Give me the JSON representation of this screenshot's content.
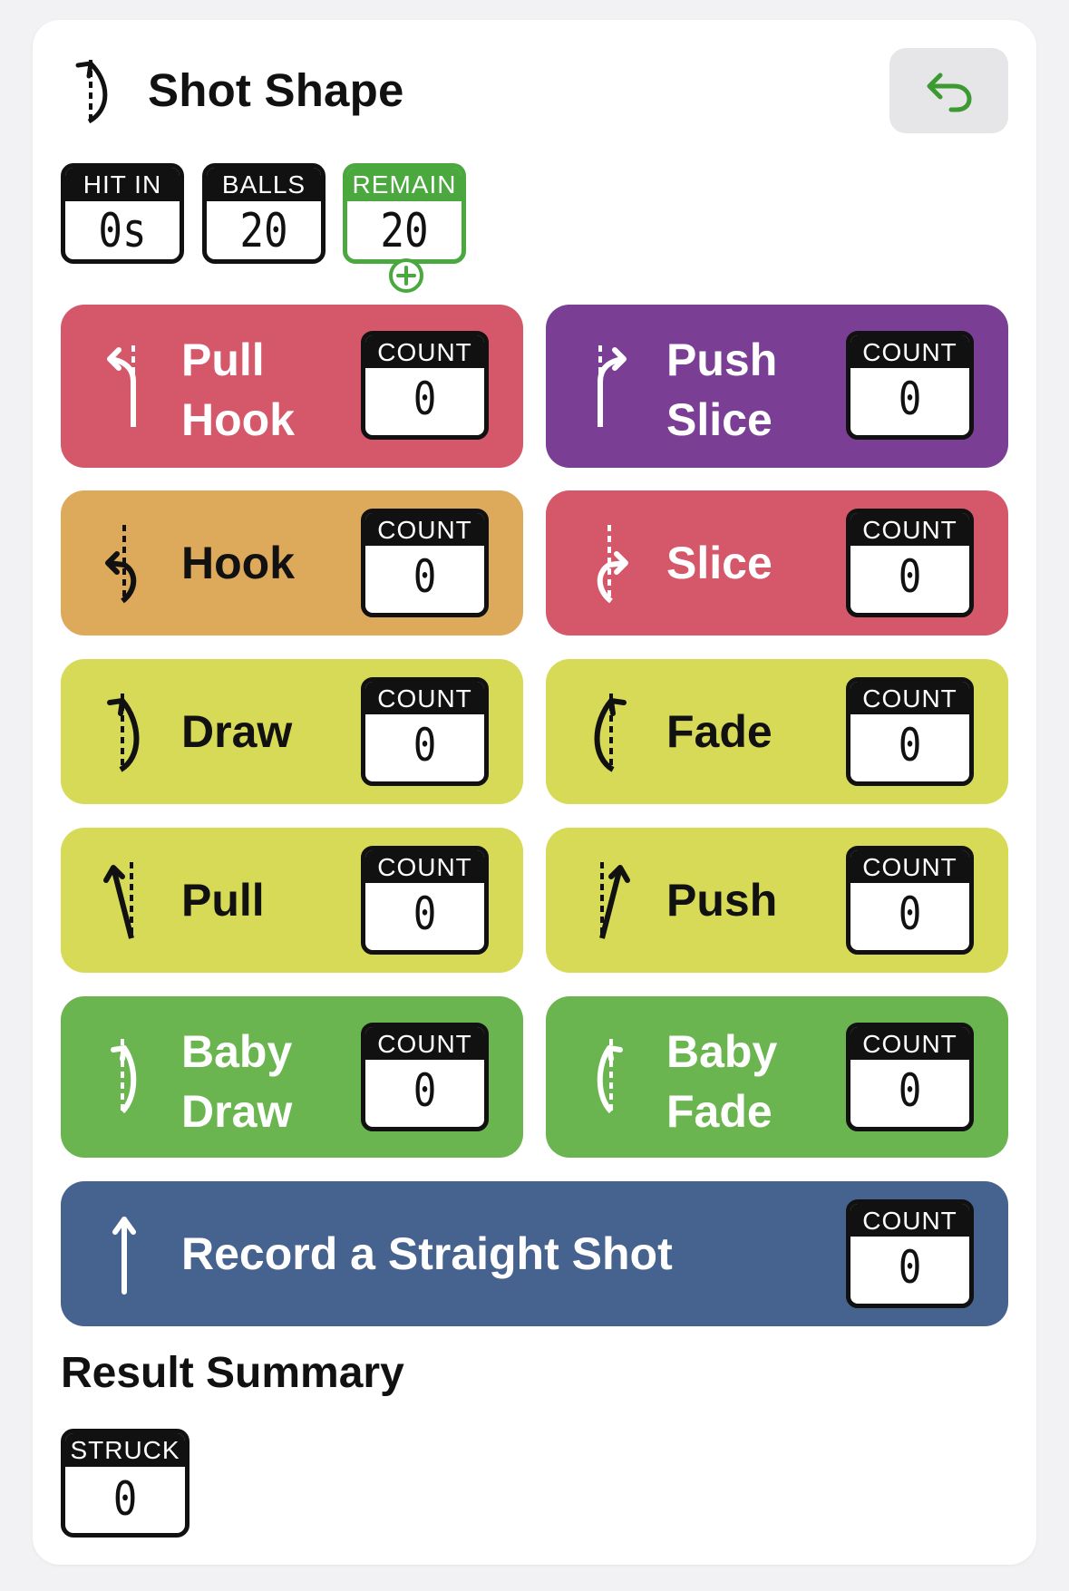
{
  "header": {
    "title": "Shot Shape",
    "icon": "draw-shape-icon",
    "undo_icon": "undo-arrow-icon"
  },
  "stats": {
    "hit_in": {
      "label": "HIT IN",
      "value": "0s"
    },
    "balls": {
      "label": "BALLS",
      "value": "20"
    },
    "remain": {
      "label": "REMAIN",
      "value": "20"
    },
    "add_icon": "plus-circle-icon"
  },
  "colors": {
    "red": "#d4576a",
    "purple": "#7a3f94",
    "orange": "#dcaa5a",
    "yellow": "#d7da57",
    "green": "#6ab54f",
    "blue": "#46628f",
    "accent_green": "#4aa83e"
  },
  "shots": {
    "pull_hook": {
      "line1": "Pull",
      "line2": "Hook",
      "count_label": "COUNT",
      "count": "0"
    },
    "push_slice": {
      "line1": "Push",
      "line2": "Slice",
      "count_label": "COUNT",
      "count": "0"
    },
    "hook": {
      "name": "Hook",
      "count_label": "COUNT",
      "count": "0"
    },
    "slice": {
      "name": "Slice",
      "count_label": "COUNT",
      "count": "0"
    },
    "draw": {
      "name": "Draw",
      "count_label": "COUNT",
      "count": "0"
    },
    "fade": {
      "name": "Fade",
      "count_label": "COUNT",
      "count": "0"
    },
    "pull": {
      "name": "Pull",
      "count_label": "COUNT",
      "count": "0"
    },
    "push": {
      "name": "Push",
      "count_label": "COUNT",
      "count": "0"
    },
    "baby_draw": {
      "line1": "Baby",
      "line2": "Draw",
      "count_label": "COUNT",
      "count": "0"
    },
    "baby_fade": {
      "line1": "Baby",
      "line2": "Fade",
      "count_label": "COUNT",
      "count": "0"
    },
    "straight": {
      "name": "Record a Straight Shot",
      "count_label": "COUNT",
      "count": "0"
    }
  },
  "summary": {
    "title": "Result Summary",
    "struck": {
      "label": "STRUCK",
      "value": "0"
    }
  }
}
